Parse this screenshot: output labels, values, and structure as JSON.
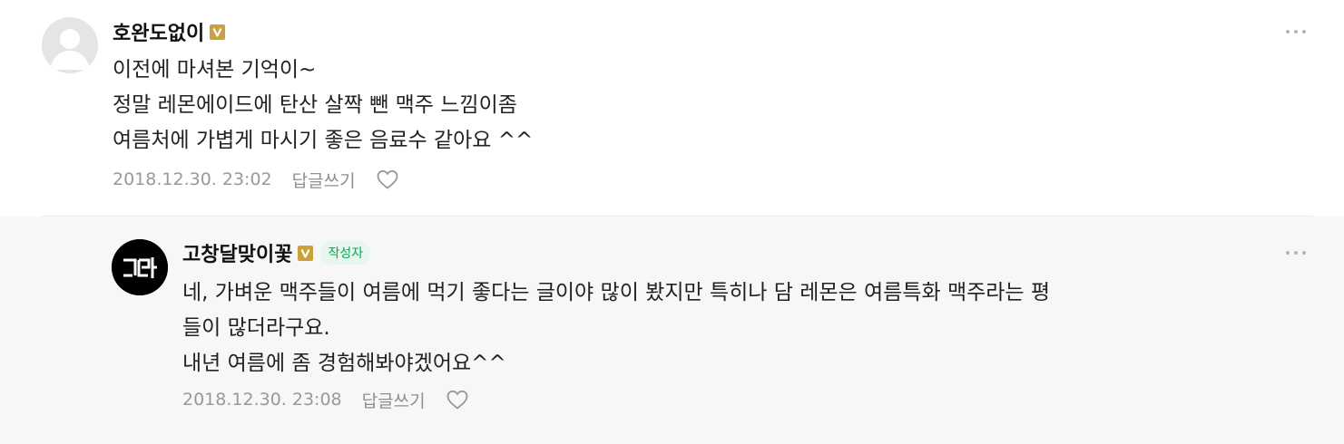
{
  "comments": [
    {
      "nickname": "호완도없이",
      "lines": [
        "이전에 마셔본 기억이~",
        "정말 레몬에이드에 탄산 살짝 뺀 맥주 느낌이좀",
        "여름처에 가볍게 마시기 좋은 음료수 같아요 ^^"
      ],
      "timestamp": "2018.12.30. 23:02",
      "reply_label": "답글쓰기",
      "avatar_icon": "default-profile-icon",
      "verified_icon": "v-badge-icon",
      "more_icon": "more-dots-icon",
      "like_icon": "heart-outline-icon"
    },
    {
      "nickname": "고창달맞이꽃",
      "author_badge": "작성자",
      "lines": [
        "네, 가벼운 맥주들이 여름에 먹기 좋다는 글이야 많이 봤지만 특히나 담 레몬은 여름특화 맥주라는 평",
        "들이 많더라구요.",
        "내년 여름에 좀 경험해봐야겠어요^^"
      ],
      "timestamp": "2018.12.30. 23:08",
      "reply_label": "답글쓰기",
      "avatar_icon": "blog-logo-avatar",
      "verified_icon": "v-badge-icon",
      "more_icon": "more-dots-icon",
      "like_icon": "heart-outline-icon"
    }
  ],
  "colors": {
    "badge_gold": "#c9a23a",
    "author_green": "#03a94e",
    "reply_bg": "#f7f7f7",
    "meta_gray": "#999999"
  }
}
